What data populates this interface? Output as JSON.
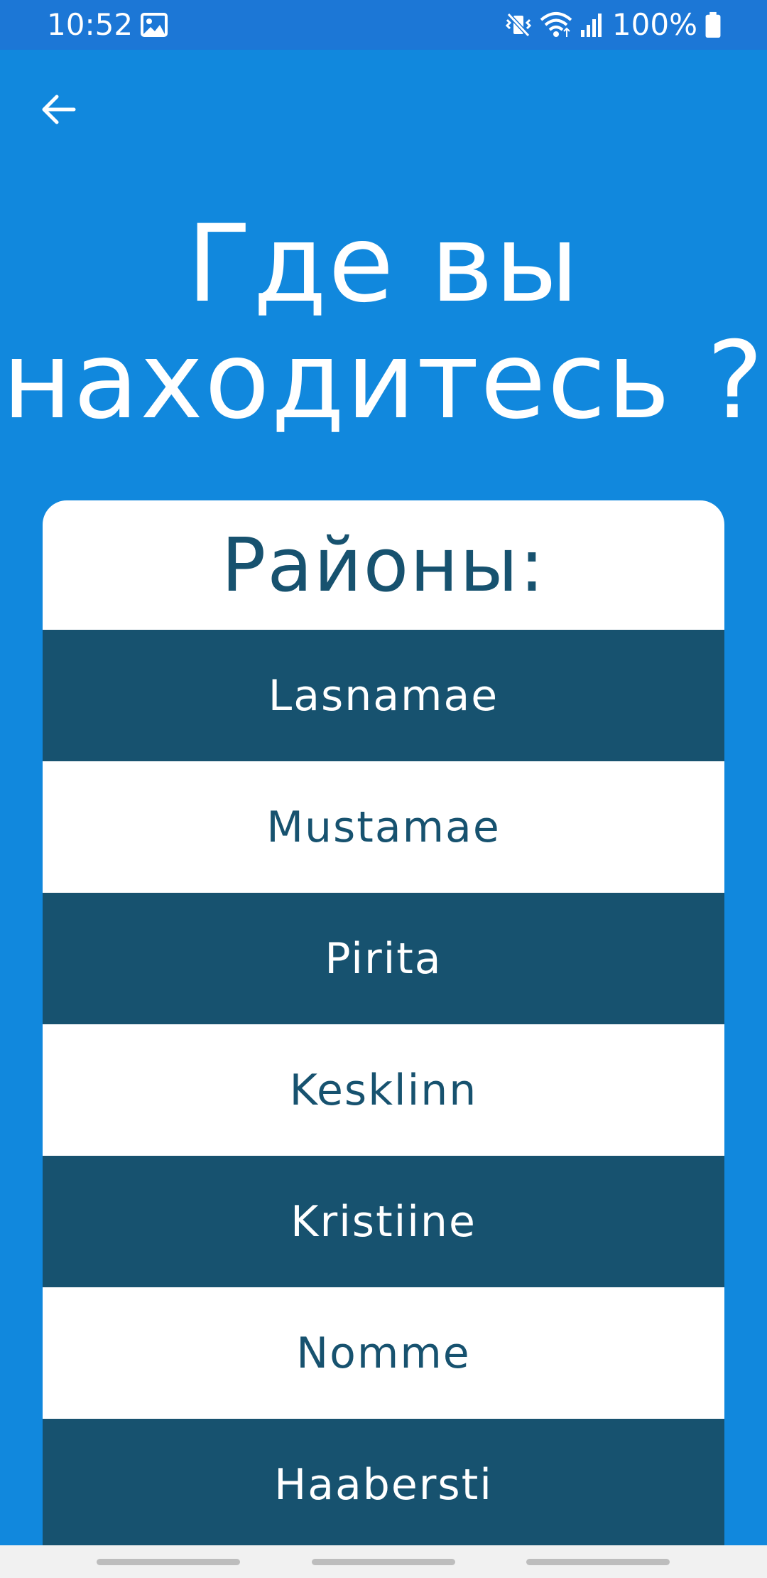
{
  "status_bar": {
    "time": "10:52",
    "battery_text": "100%",
    "icons": [
      "gallery-icon",
      "mute-vibrate-icon",
      "wifi-icon",
      "signal-icon",
      "battery-icon"
    ]
  },
  "header": {
    "back_icon": "arrow-left-icon",
    "title": "Где вы\nнаходитесь ?"
  },
  "card": {
    "title": "Районы:",
    "districts": [
      {
        "label": "Lasnamae"
      },
      {
        "label": "Mustamae"
      },
      {
        "label": "Pirita"
      },
      {
        "label": "Kesklinn"
      },
      {
        "label": "Kristiine"
      },
      {
        "label": "Nomme"
      },
      {
        "label": "Haabersti"
      }
    ]
  },
  "colors": {
    "background": "#1188dd",
    "status_bar": "#1c77d6",
    "dark_row": "#17526f",
    "light_row": "#ffffff"
  }
}
